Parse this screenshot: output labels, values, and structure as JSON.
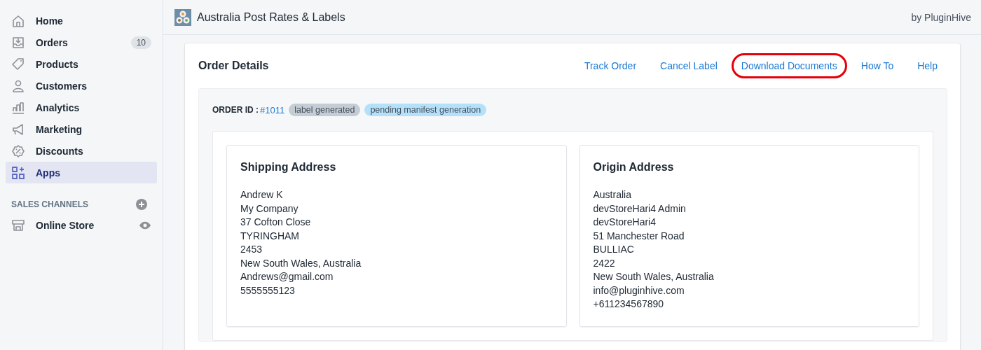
{
  "sidebar": {
    "items": [
      {
        "kind": "home",
        "label": "Home",
        "selected": false
      },
      {
        "kind": "orders",
        "label": "Orders",
        "badge": "10",
        "selected": false
      },
      {
        "kind": "products",
        "label": "Products",
        "selected": false
      },
      {
        "kind": "customers",
        "label": "Customers",
        "selected": false
      },
      {
        "kind": "analytics",
        "label": "Analytics",
        "selected": false
      },
      {
        "kind": "marketing",
        "label": "Marketing",
        "selected": false
      },
      {
        "kind": "discounts",
        "label": "Discounts",
        "selected": false
      },
      {
        "kind": "apps",
        "label": "Apps",
        "selected": true
      }
    ],
    "section_title": "SALES CHANNELS",
    "channels": [
      {
        "kind": "store",
        "label": "Online Store"
      }
    ]
  },
  "app_bar": {
    "title": "Australia Post Rates & Labels",
    "byline": "by PluginHive"
  },
  "card": {
    "title": "Order Details",
    "actions": [
      {
        "label": "Track Order",
        "highlighted": false
      },
      {
        "label": "Cancel Label",
        "highlighted": false
      },
      {
        "label": "Download Documents",
        "highlighted": true
      },
      {
        "label": "How To",
        "highlighted": false
      },
      {
        "label": "Help",
        "highlighted": false
      }
    ],
    "order_label": "ORDER ID :",
    "order_id": "#1011",
    "badges": [
      {
        "label": "label generated",
        "color": "#c4cdd5"
      },
      {
        "label": "pending manifest generation",
        "color": "#b4e1fa"
      }
    ],
    "addresses": [
      {
        "title": "Shipping Address",
        "lines": [
          "Andrew K",
          "My Company",
          "37 Cofton Close",
          "TYRINGHAM",
          "2453",
          "New South Wales, Australia",
          "Andrews@gmail.com",
          "5555555123"
        ]
      },
      {
        "title": "Origin Address",
        "lines": [
          "Australia",
          "devStoreHari4 Admin",
          "devStoreHari4",
          "51 Manchester Road",
          "BULLIAC",
          "2422",
          "New South Wales, Australia",
          "info@pluginhive.com",
          "+611234567890"
        ]
      }
    ]
  }
}
